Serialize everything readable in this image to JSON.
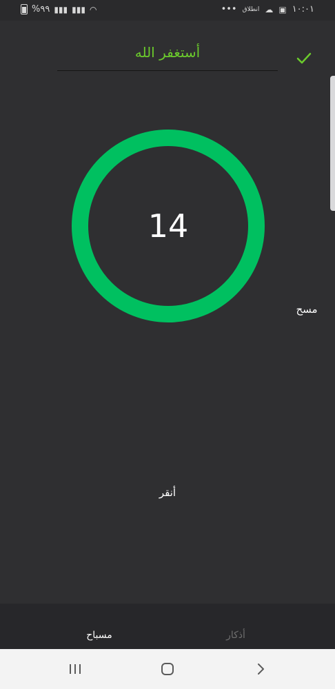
{
  "status_bar": {
    "time": "١٠:٠١",
    "network_label": "انطلاق",
    "more_dots": "•••",
    "battery": "%٩٩"
  },
  "header": {
    "dhikr_text": "أستغفر الله"
  },
  "counter": {
    "count": "14",
    "ring_color": "#00c060"
  },
  "actions": {
    "clear_label": "مسح",
    "tap_label": "أنقر"
  },
  "tabs": [
    {
      "label": "مسباح",
      "active": true
    },
    {
      "label": "أذكار",
      "active": false
    }
  ],
  "colors": {
    "accent_green": "#6bcb2c",
    "background": "#2f2f31"
  }
}
